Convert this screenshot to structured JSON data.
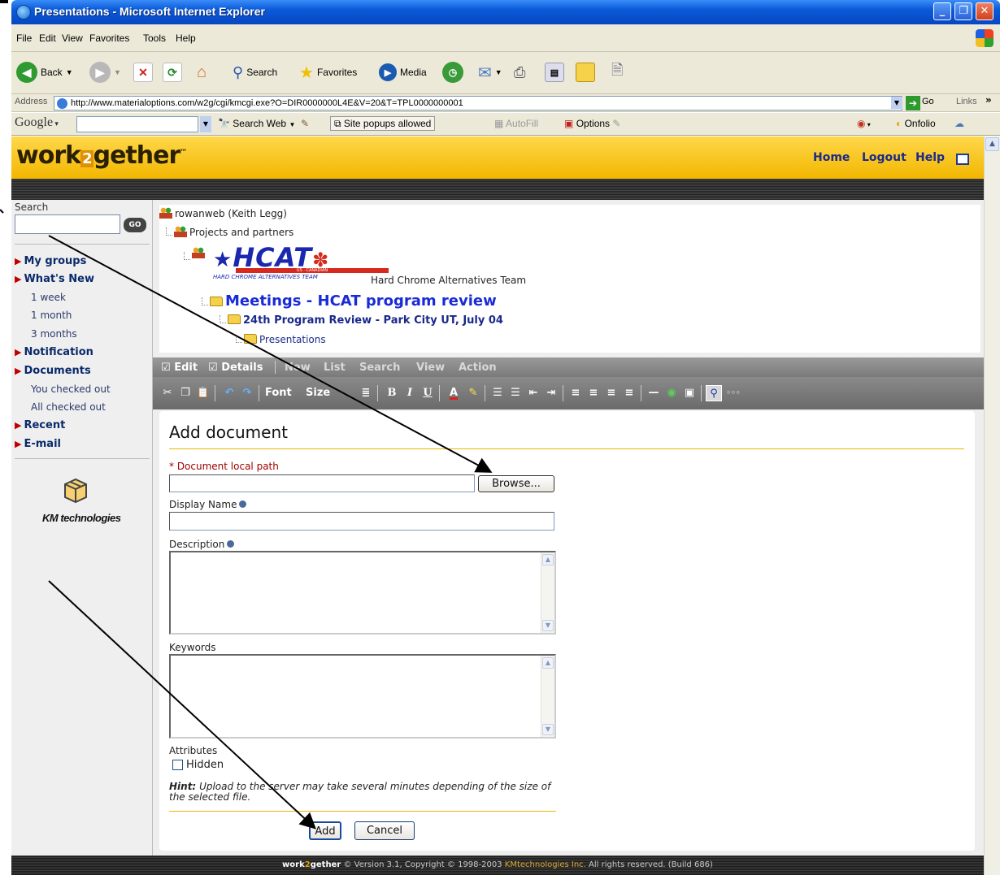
{
  "window": {
    "title": "Presentations - Microsoft Internet Explorer",
    "controls": [
      "_",
      "❐",
      "✕"
    ]
  },
  "menu": [
    "File",
    "Edit",
    "View",
    "Favorites",
    "Tools",
    "Help"
  ],
  "toolbar": {
    "back": "Back",
    "search": "Search",
    "favorites": "Favorites",
    "media": "Media"
  },
  "address": {
    "label": "Address",
    "url": "http://www.materialoptions.com/w2g/cgi/kmcgi.exe?O=DIR0000000L4E&V=20&T=TPL0000000001",
    "go": "Go",
    "links": "Links"
  },
  "googlebar": {
    "logo": "Google",
    "search_web": "Search Web",
    "popups": "Site popups allowed",
    "autofill": "AutoFill",
    "options": "Options",
    "onfolio": "Onfolio"
  },
  "app": {
    "logo_a": "work",
    "logo_b": "2",
    "logo_c": "gether",
    "logo_tm": "™",
    "top_links": [
      "Home",
      "Logout",
      "Help"
    ]
  },
  "sidebar": {
    "search_label": "Search",
    "go": "GO",
    "groups": [
      {
        "label": "My groups",
        "items": []
      },
      {
        "label": "What's New",
        "items": [
          "1 week",
          "1 month",
          "3 months"
        ]
      },
      {
        "label": "Notification",
        "items": []
      },
      {
        "label": "Documents",
        "items": [
          "You checked out",
          "All checked out"
        ]
      },
      {
        "label": "Recent",
        "items": []
      },
      {
        "label": "E-mail",
        "items": []
      }
    ],
    "km_logo_text": "KM technologies"
  },
  "tree": {
    "user": "rowanweb (Keith Legg)",
    "projects": "Projects and partners",
    "hcat_logo": "HCAT",
    "hcat_small": "HARD CHROME ALTERNATIVES TEAM",
    "hcat_sub": "US · CANADIAN",
    "team": "Hard Chrome Alternatives Team",
    "meetings": "Meetings - HCAT program review",
    "review": "24th Program Review - Park City UT, July 04",
    "presentations": "Presentations"
  },
  "editbar": {
    "edit": "Edit",
    "details": "Details",
    "actions": [
      "New",
      "List",
      "Search",
      "View",
      "Action"
    ],
    "font": "Font",
    "size": "Size"
  },
  "form": {
    "title": "Add document",
    "path_label": "* Document local path",
    "browse": "Browse...",
    "display_name_label": "Display Name",
    "description_label": "Description",
    "keywords_label": "Keywords",
    "attributes_label": "Attributes",
    "hidden_label": "Hidden",
    "hidden_checked": false,
    "hint_label": "Hint:",
    "hint_text": "Upload to the server may take several minutes depending of the size of the selected file.",
    "add": "Add",
    "cancel": "Cancel"
  },
  "footer": {
    "brand_a": "work",
    "brand_b": "2",
    "brand_c": "gether",
    "version": "© Version 3.1, Copyright © 1998-2003 ",
    "company": "KMtechnologies Inc.",
    "rights": " All rights reserved. (Build 686)"
  }
}
